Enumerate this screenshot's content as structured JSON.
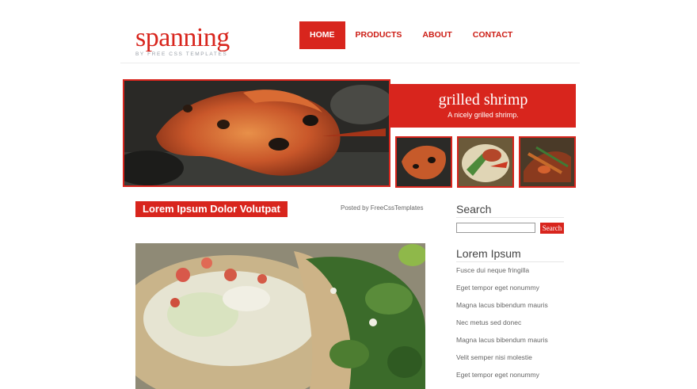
{
  "header": {
    "logo_title": "spanning",
    "logo_tagline": "BY FREE CSS TEMPLATES",
    "nav": [
      {
        "label": "HOME",
        "active": true
      },
      {
        "label": "PRODUCTS",
        "active": false
      },
      {
        "label": "ABOUT",
        "active": false
      },
      {
        "label": "CONTACT",
        "active": false
      }
    ]
  },
  "feature": {
    "title": "grilled shrimp",
    "caption": "A nicely grilled shrimp.",
    "accent_color": "#d8251d"
  },
  "post": {
    "title": "Lorem Ipsum Dolor Volutpat",
    "posted_by": "Posted by FreeCssTemplates"
  },
  "sidebar": {
    "search_heading": "Search",
    "search_value": "",
    "search_button": "Search",
    "links_heading": "Lorem Ipsum",
    "links": [
      "Fusce dui neque fringilla",
      "Eget tempor eget nonummy",
      "Magna lacus bibendum mauris",
      "Nec metus sed donec",
      "Magna lacus bibendum mauris",
      "Velit semper nisi molestie",
      "Eget tempor eget nonummy"
    ]
  }
}
